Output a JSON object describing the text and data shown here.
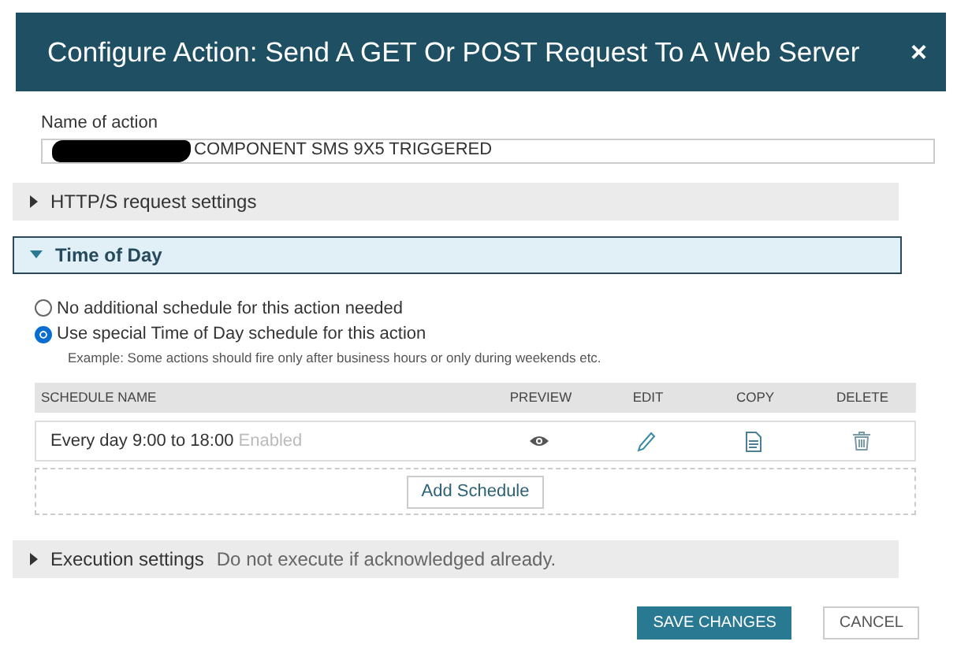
{
  "dialog": {
    "title": "Configure Action: Send A GET Or POST Request To A Web Server",
    "close": "×"
  },
  "name_field": {
    "label": "Name of action",
    "value": "COMPONENT SMS 9X5 TRIGGERED"
  },
  "sections": [
    {
      "title": "HTTP/S request settings",
      "expanded": false
    },
    {
      "title": "Time of Day",
      "expanded": true
    },
    {
      "title": "Execution settings",
      "expanded": false,
      "summary": "Do not execute if acknowledged already."
    }
  ],
  "time_of_day": {
    "options": [
      {
        "label": "No additional schedule for this action needed",
        "selected": false
      },
      {
        "label": "Use special Time of Day schedule for this action",
        "selected": true,
        "hint": "Example: Some actions should fire only after business hours or only during weekends etc."
      }
    ],
    "table": {
      "columns": [
        "SCHEDULE NAME",
        "PREVIEW",
        "EDIT",
        "COPY",
        "DELETE"
      ],
      "rows": [
        {
          "name": "Every day 9:00 to 18:00",
          "status": "Enabled"
        }
      ]
    },
    "add_button": "Add Schedule"
  },
  "buttons": [
    {
      "label": "SAVE CHANGES",
      "kind": "primary"
    },
    {
      "label": "CANCEL",
      "kind": "secondary"
    }
  ]
}
